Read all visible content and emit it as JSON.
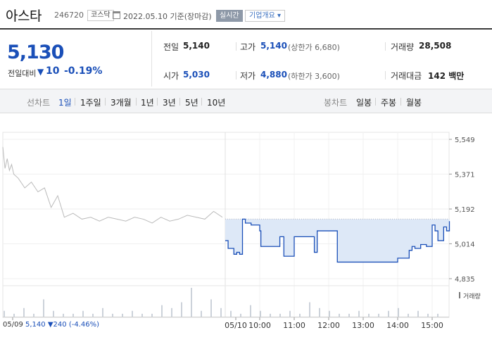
{
  "header": {
    "name": "아스타",
    "code": "246720",
    "market": "코스닥",
    "date": "2022.05.10 기준(장마감)",
    "realtime": "실시간",
    "company": "기업개요 ▾"
  },
  "price": {
    "current": "5,130",
    "change_label": "전일대비",
    "change_arrow": "▼",
    "change_value": "10",
    "change_rate": "-0.19%"
  },
  "stats": {
    "prev_label": "전일",
    "prev_value": "5,140",
    "open_label": "시가",
    "open_value": "5,030",
    "high_label": "고가",
    "high_value": "5,140",
    "high_sub": "(상한가 6,680)",
    "low_label": "저가",
    "low_value": "4,880",
    "low_sub": "(하한가 3,600)",
    "volume_label": "거래량",
    "volume_value": "28,508",
    "amount_label": "거래대금",
    "amount_value": "142 백만"
  },
  "periods": {
    "line_label": "선차트",
    "line_items": [
      "1일",
      "1주일",
      "3개월",
      "1년",
      "3년",
      "5년",
      "10년"
    ],
    "active": "1일",
    "candle_label": "봉차트",
    "candle_items": [
      "일봉",
      "주봉",
      "월봉"
    ]
  },
  "volume_label": "거래량",
  "prev_info": {
    "date": "05/09",
    "price": "5,140",
    "change": "▼240",
    "rate": "(-4.46%)"
  },
  "colors": {
    "accent": "#1a4fb8",
    "fill": "#dde8f7",
    "prev_line": "#bbbbbb"
  },
  "chart_data": {
    "type": "area",
    "y_ticks": [
      "5,549",
      "5,371",
      "5,192",
      "5,014",
      "4,835"
    ],
    "ylim": [
      4835,
      5549
    ],
    "x_ticks": [
      "05/09",
      "05/10",
      "10:00",
      "11:00",
      "12:00",
      "13:00",
      "14:00",
      "15:00"
    ],
    "reference_price": 5140,
    "series": [
      {
        "name": "05/09",
        "x": [
          0,
          0.01,
          0.02,
          0.03,
          0.04,
          0.05,
          0.07,
          0.1,
          0.13,
          0.16,
          0.19,
          0.22,
          0.25,
          0.28,
          0.32,
          0.36,
          0.4,
          0.44,
          0.48,
          0.52,
          0.56,
          0.6,
          0.64,
          0.68,
          0.72,
          0.76,
          0.8,
          0.84,
          0.88,
          0.92,
          0.96,
          1.0
        ],
        "values": [
          5510,
          5400,
          5450,
          5390,
          5420,
          5370,
          5350,
          5300,
          5330,
          5280,
          5300,
          5200,
          5260,
          5150,
          5170,
          5140,
          5150,
          5130,
          5150,
          5140,
          5130,
          5150,
          5140,
          5120,
          5150,
          5130,
          5140,
          5160,
          5150,
          5140,
          5180,
          5150
        ]
      },
      {
        "name": "05/10",
        "x": [
          "09:00",
          "09:05",
          "09:15",
          "09:20",
          "09:25",
          "09:30",
          "09:35",
          "09:40",
          "09:45",
          "09:55",
          "10:00",
          "10:02",
          "10:20",
          "10:35",
          "10:40",
          "10:42",
          "10:55",
          "11:00",
          "11:02",
          "11:15",
          "11:30",
          "11:35",
          "11:38",
          "11:40",
          "11:50",
          "11:55",
          "12:10",
          "12:15",
          "12:30",
          "13:00",
          "13:30",
          "13:50",
          "14:00",
          "14:20",
          "14:25",
          "14:30",
          "14:40",
          "14:50",
          "15:00",
          "15:05",
          "15:10",
          "15:15",
          "15:20",
          "15:25",
          "15:30"
        ],
        "values": [
          5030,
          4990,
          4960,
          4970,
          4960,
          5140,
          5120,
          5120,
          5110,
          5110,
          5080,
          5000,
          5000,
          5050,
          5050,
          4950,
          4950,
          5050,
          5050,
          5050,
          5050,
          4970,
          4970,
          5080,
          5080,
          5080,
          5080,
          4920,
          4920,
          4920,
          4920,
          4920,
          4940,
          4980,
          5000,
          4990,
          5010,
          5000,
          5110,
          5080,
          5030,
          5030,
          5100,
          5080,
          5130
        ]
      }
    ],
    "volume": [
      2,
      1,
      3,
      1,
      6,
      2,
      1,
      1,
      2,
      1,
      3,
      1,
      1,
      2,
      1,
      1,
      4,
      3,
      5,
      10,
      2,
      6,
      3,
      2,
      1,
      4,
      2,
      1,
      1,
      2,
      1,
      5,
      3,
      2,
      1,
      1,
      2,
      1,
      1,
      2,
      3,
      1,
      2,
      1,
      1
    ]
  }
}
